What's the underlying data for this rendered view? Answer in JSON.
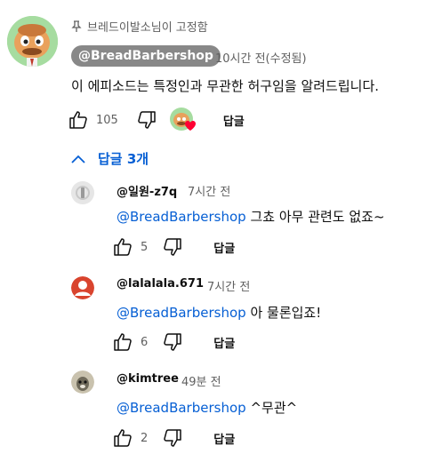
{
  "pinned_label": "브레드이발소님이 고정함",
  "top_comment": {
    "author": "@BreadBarbershop",
    "time": "10시간 전(수정됨)",
    "text": "이 에피소드는 특정인과 무관한 허구임을 알려드립니다.",
    "likes": "105",
    "reply_label": "답글"
  },
  "replies_toggle_label": "답글 3개",
  "replies": [
    {
      "handle": "@일원-z7q",
      "time": "7시간 전",
      "mention": "@BreadBarbershop",
      "text": "그쵸 아무 관련도 없죠~",
      "likes": "5",
      "reply_label": "답글"
    },
    {
      "handle": "@lalalala.671",
      "time": "7시간 전",
      "mention": "@BreadBarbershop",
      "text": "아 물론입죠!",
      "likes": "6",
      "reply_label": "답글"
    },
    {
      "handle": "@kimtree",
      "time": "49분 전",
      "mention": "@BreadBarbershop",
      "text": "^무관^",
      "likes": "2",
      "reply_label": "답글"
    }
  ],
  "colors": {
    "link": "#065fd4",
    "meta": "#606060",
    "heart": "#ff0033",
    "chip": "#888888"
  },
  "icons": [
    "pin-icon",
    "thumbs-up-icon",
    "thumbs-down-icon",
    "creator-heart-icon",
    "chevron-up-icon"
  ]
}
